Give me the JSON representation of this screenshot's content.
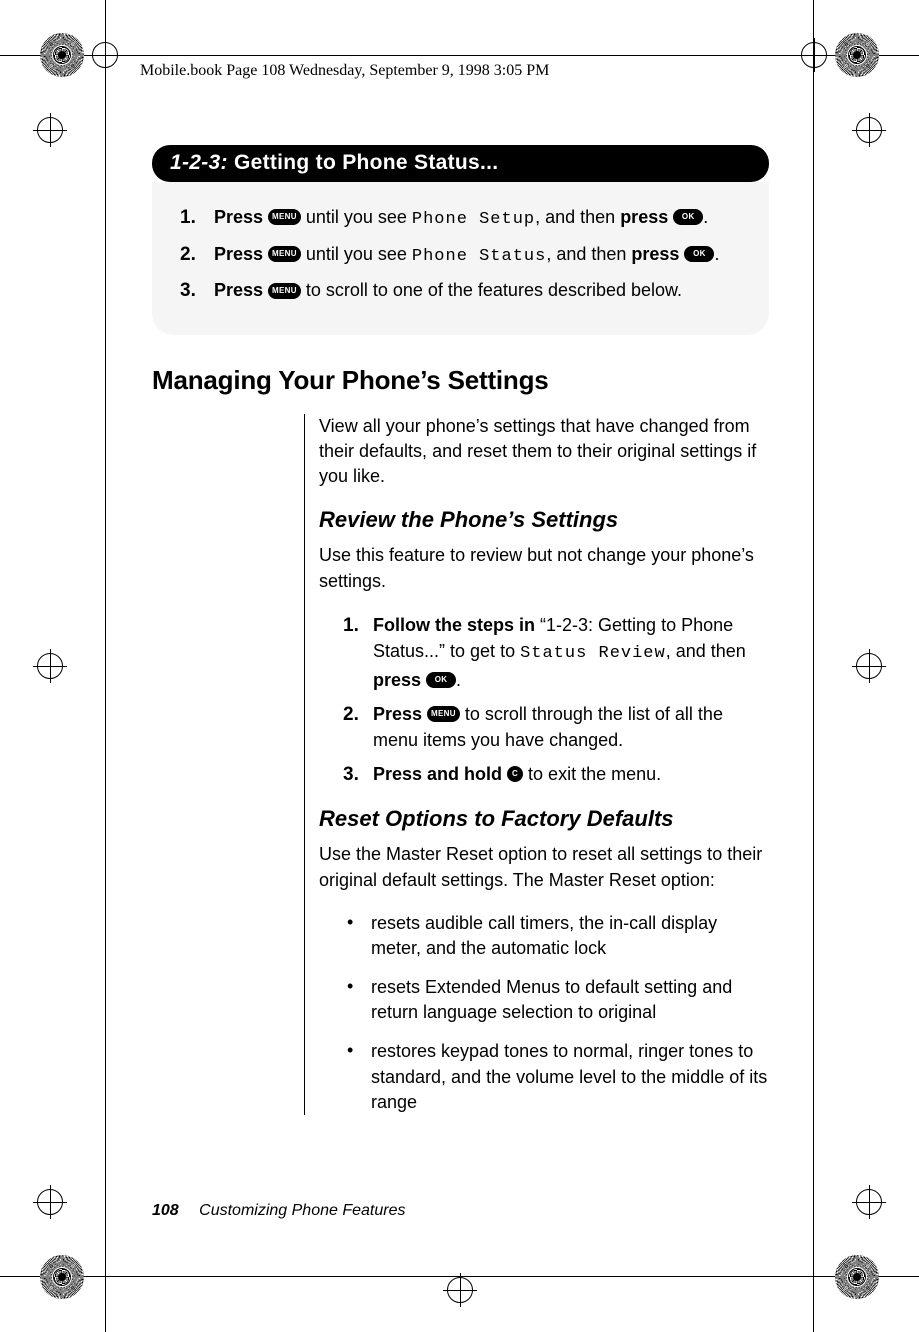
{
  "header_text": "Mobile.book  Page 108  Wednesday, September 9, 1998  3:05 PM",
  "banner": {
    "prefix": "1-2-3:",
    "title": " Getting to Phone Status..."
  },
  "icons": {
    "menu": "MENU",
    "ok": "OK",
    "c": "C"
  },
  "top_steps": [
    {
      "n": "1.",
      "a": "Press ",
      "mid": " until you see ",
      "lcd": "Phone Setup",
      "tail": ", and then ",
      "b2": "press ",
      "end": "."
    },
    {
      "n": "2.",
      "a": "Press ",
      "mid": " until you see ",
      "lcd": "Phone Status",
      "tail": ", and then ",
      "b2": "press ",
      "end": "."
    },
    {
      "n": "3.",
      "a": "Press ",
      "mid": " to scroll to one of the features described below."
    }
  ],
  "h2": "Managing Your Phone’s Settings",
  "intro": "View all your phone’s settings that have changed from their defaults, and reset them to their original settings if you like.",
  "sub1": "Review the Phone’s Settings",
  "sub1_intro": "Use this feature to review but not change your phone’s settings.",
  "sub1_steps": {
    "s1": {
      "n": "1.",
      "b": "Follow the steps in ",
      "q": "“1-2-3: Getting to Phone Status...” to get to ",
      "lcd": "Status Review",
      "tail": ", and then ",
      "b2": "press ",
      "end": "."
    },
    "s2": {
      "n": "2.",
      "b": "Press ",
      "tail": "  to scroll through the list of all the menu items you have changed."
    },
    "s3": {
      "n": "3.",
      "b": "Press and hold ",
      "tail": " to exit the menu."
    }
  },
  "sub2": "Reset Options to Factory Defaults",
  "sub2_intro": "Use the Master Reset option to reset all settings to their original default settings. The Master Reset option:",
  "bullets": [
    "resets audible call timers, the in-call display meter, and the automatic lock",
    "resets Extended Menus to default setting and return language selection to original",
    "restores keypad tones to normal, ringer tones to standard, and the volume level to the middle of its range"
  ],
  "footer": {
    "page": "108",
    "title": "Customizing Phone Features"
  }
}
